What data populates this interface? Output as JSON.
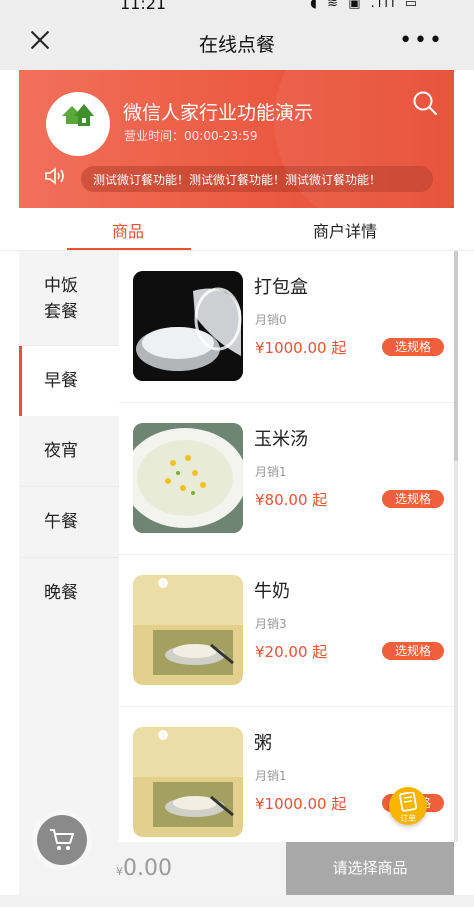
{
  "status_bar": {
    "time": "11:21",
    "icons": "◖ ≋ ▣ .ıll ▭"
  },
  "nav": {
    "title": "在线点餐",
    "more": "•••"
  },
  "shop": {
    "name": "微信人家行业功能演示",
    "hours": "营业时间：00:00-23:59",
    "notice": "测试微订餐功能！测试微订餐功能！测试微订餐功能！"
  },
  "tabs": [
    {
      "label": "商品",
      "active": true
    },
    {
      "label": "商户详情",
      "active": false
    }
  ],
  "categories": [
    {
      "label": "中饭\n套餐",
      "active": false
    },
    {
      "label": "早餐",
      "active": true
    },
    {
      "label": "夜宵",
      "active": false
    },
    {
      "label": "午餐",
      "active": false
    },
    {
      "label": "晚餐",
      "active": false
    }
  ],
  "products": [
    {
      "name": "打包盒",
      "sales": "月销0",
      "price": "¥1000.00 起",
      "spec_button": "选规格"
    },
    {
      "name": "玉米汤",
      "sales": "月销1",
      "price": "¥80.00 起",
      "spec_button": "选规格"
    },
    {
      "name": "牛奶",
      "sales": "月销3",
      "price": "¥20.00 起",
      "spec_button": "选规格"
    },
    {
      "name": "粥",
      "sales": "月销1",
      "price": "¥1000.00 起",
      "spec_button": "选规格"
    }
  ],
  "cart": {
    "currency": "¥",
    "total": "0.00",
    "checkout_label": "请选择商品",
    "order_fab_label": "订单"
  },
  "colors": {
    "accent": "#e8532f",
    "header": "#eb5a43",
    "fab": "#f7b500"
  }
}
